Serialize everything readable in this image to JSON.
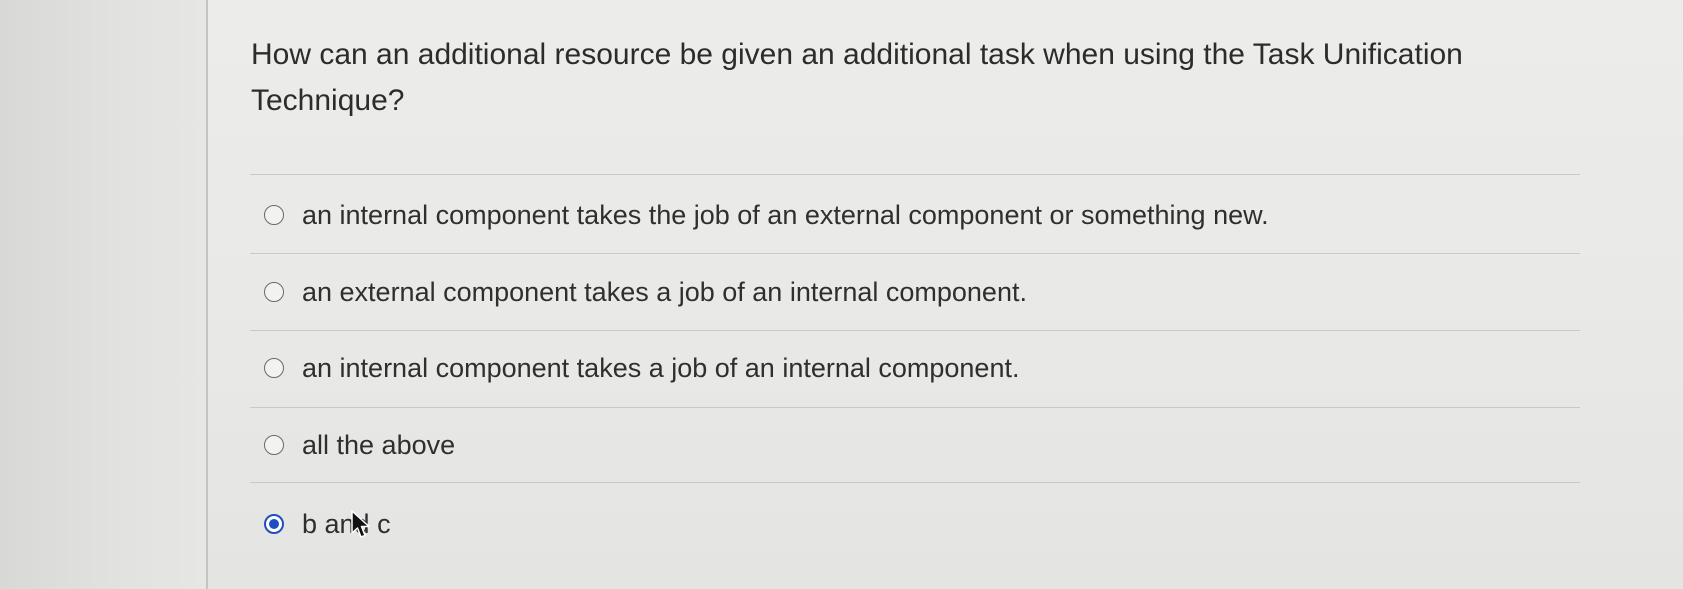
{
  "question": {
    "text": "How can an additional resource be given an additional task when using the Task Unification Technique?"
  },
  "options": [
    {
      "label": "an internal component takes the job of an external component or something new.",
      "selected": false
    },
    {
      "label": "an external component takes a job of an internal component.",
      "selected": false
    },
    {
      "label": "an internal component takes a job of an internal component.",
      "selected": false
    },
    {
      "label": "all the above",
      "selected": false
    },
    {
      "label": "b and c",
      "selected": true
    }
  ],
  "colors": {
    "selected_radio": "#1f4ec0",
    "text": "#2f2f2f"
  }
}
